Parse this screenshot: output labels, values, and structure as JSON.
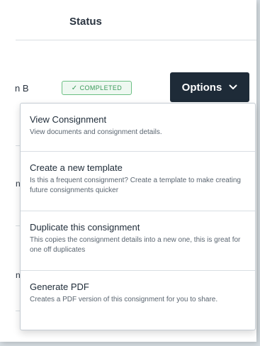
{
  "table": {
    "status_header": "Status",
    "row": {
      "name_fragment": "n B",
      "status_badge": "COMPLETED",
      "status_icon": "check-icon"
    },
    "edge_fragments": [
      "n",
      "n",
      "n"
    ]
  },
  "options_button": {
    "label": "Options",
    "icon": "chevron-down-icon"
  },
  "menu": {
    "items": [
      {
        "title": "View Consignment",
        "description": "View documents and consignment details."
      },
      {
        "title": "Create a new template",
        "description": "Is this a frequent consignment? Create a template to make creating future consignments quicker"
      },
      {
        "title": "Duplicate this consignment",
        "description": "This copies the consignment details into a new one, this is great for one off duplicates"
      },
      {
        "title": "Generate PDF",
        "description": "Creates a PDF version of this consignment for you to share."
      }
    ]
  },
  "colors": {
    "button_bg": "#1e2b38",
    "badge_green": "#3a9a5a",
    "background": "#d6dde2"
  }
}
